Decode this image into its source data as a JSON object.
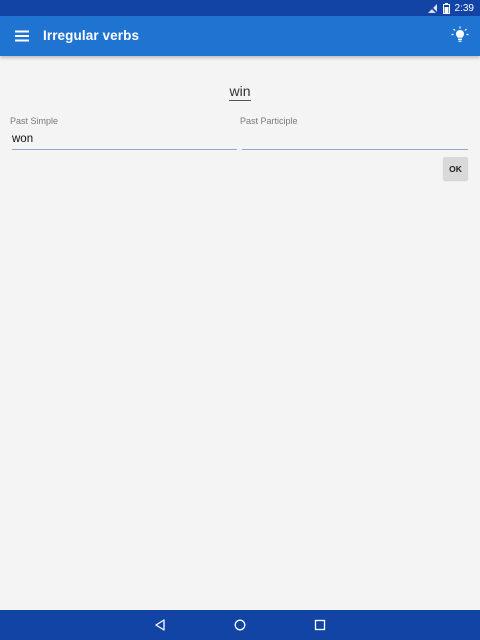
{
  "status_bar": {
    "time": "2:39",
    "icons": [
      "signal-off-icon",
      "battery-icon"
    ]
  },
  "app_bar": {
    "menu_icon": "menu-icon",
    "title": "Irregular verbs",
    "action_icon": "lightbulb-icon"
  },
  "quiz": {
    "verb": "win",
    "past_simple": {
      "label": "Past Simple",
      "value": "won",
      "placeholder": ""
    },
    "past_participle": {
      "label": "Past Participle",
      "value": "",
      "placeholder": ""
    },
    "ok_label": "OK"
  },
  "nav_bar": {
    "buttons": [
      "back-icon",
      "home-icon",
      "recents-icon"
    ]
  },
  "colors": {
    "status_bar": "#1244a6",
    "app_bar": "#1f73d1",
    "background": "#f4f4f5",
    "nav_bar": "#1244a6"
  }
}
